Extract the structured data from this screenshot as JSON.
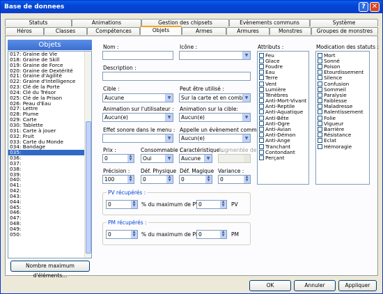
{
  "window": {
    "title": "Base de donnees",
    "help": "?",
    "close": "✕"
  },
  "tabs_row1": [
    "Statuts",
    "Animations",
    "Gestion des chipsets",
    "Evènements communs",
    "Système"
  ],
  "tabs_row2": [
    "Héros",
    "Classes",
    "Compétences",
    "Objets",
    "Armes",
    "Armures",
    "Monstres",
    "Groupes de monstres"
  ],
  "objets_header": "Objets",
  "items": [
    "017: Graine de Vie",
    "018: Graine de Skill",
    "019: Graine de Force",
    "020: Graine de Dextérité",
    "021: Graine d'Agilité",
    "022: Graine d'Intelligence",
    "023: Clé de la Porte",
    "024: Clé du Trésor",
    "025: Clé de la Prison",
    "026: Peau d'Eau",
    "027: Lettre",
    "028: Plume",
    "029: Carte",
    "030: Tablette",
    "031: Carte à jouer",
    "032: Fruit",
    "033: Carte du Monde",
    "034: Bandage",
    "035:",
    "036:",
    "037:",
    "038:",
    "039:",
    "040:",
    "041:",
    "042:",
    "043:",
    "044:",
    "045:",
    "046:",
    "047:",
    "048:",
    "049:",
    "050:"
  ],
  "selected_item": "035:",
  "max_button": "Nombre maximum d'éléments...",
  "form": {
    "nom": "Nom :",
    "icone": "Icône :",
    "description": "Description :",
    "cible": "Cible :",
    "cible_val": "Aucune",
    "peut_etre": "Peut être utilisé :",
    "peut_etre_val": "Sur la carte et en combat",
    "anim_user": "Animation sur l'utilisateur :",
    "anim_user_val": "Aucun(e)",
    "anim_cible": "Animation sur la cible:",
    "anim_cible_val": "Aucun(e)",
    "effet": "Effet sonore dans le menu :",
    "appelle": "Appelle un évènement commun :",
    "appelle_val": "Aucun(e)",
    "prix": "Prix :",
    "prix_val": "0",
    "consommable": "Consommable :",
    "consommable_val": "Oui",
    "carac": "Caractéristique :",
    "carac_val": "Aucune",
    "augmentee": "Augmentée de",
    "precision": "Précision :",
    "precision_val": "100",
    "def_phys": "Déf. Physique",
    "def_phys_val": "0",
    "def_mag": "Déf. Magique",
    "def_mag_val": "0",
    "variance": "Variance :",
    "variance_val": "0",
    "pv_group": "PV récupérés :",
    "pv_val": "0",
    "pv_txt": "% du maximum de PV +",
    "pv_val2": "0",
    "pv_unit": "PV",
    "pm_group": "PM récupérés :",
    "pm_val": "0",
    "pm_txt": "% du maximum de PM +",
    "pm_val2": "0",
    "pm_unit": "PM"
  },
  "attributs_label": "Attributs :",
  "attributs": [
    "Feu",
    "Glace",
    "Foudre",
    "Eau",
    "Terre",
    "Vent",
    "Lumière",
    "Ténèbres",
    "Anti-Mort-Vivant",
    "Anti-Reptile",
    "Anti-Aquatique",
    "Anti-Bête",
    "Anti-Ogre",
    "Anti-Avian",
    "Anti-Démon",
    "Anti-Ange",
    "Tranchant",
    "Contondant",
    "Perçant"
  ],
  "statuts_label": "Modication des statuts :",
  "statuts": [
    "Mort",
    "Sonné",
    "Poison",
    "Etourdissement",
    "Silence",
    "Confusion",
    "Sommeil",
    "Paralysie",
    "Faiblesse",
    "Maladresse",
    "Ralentissement",
    "Folie",
    "Vigueur",
    "Barrière",
    "Résistance",
    "Eclat",
    "Hémoragie"
  ],
  "buttons": {
    "ok": "OK",
    "annuler": "Annuler",
    "appliquer": "Appliquer"
  }
}
